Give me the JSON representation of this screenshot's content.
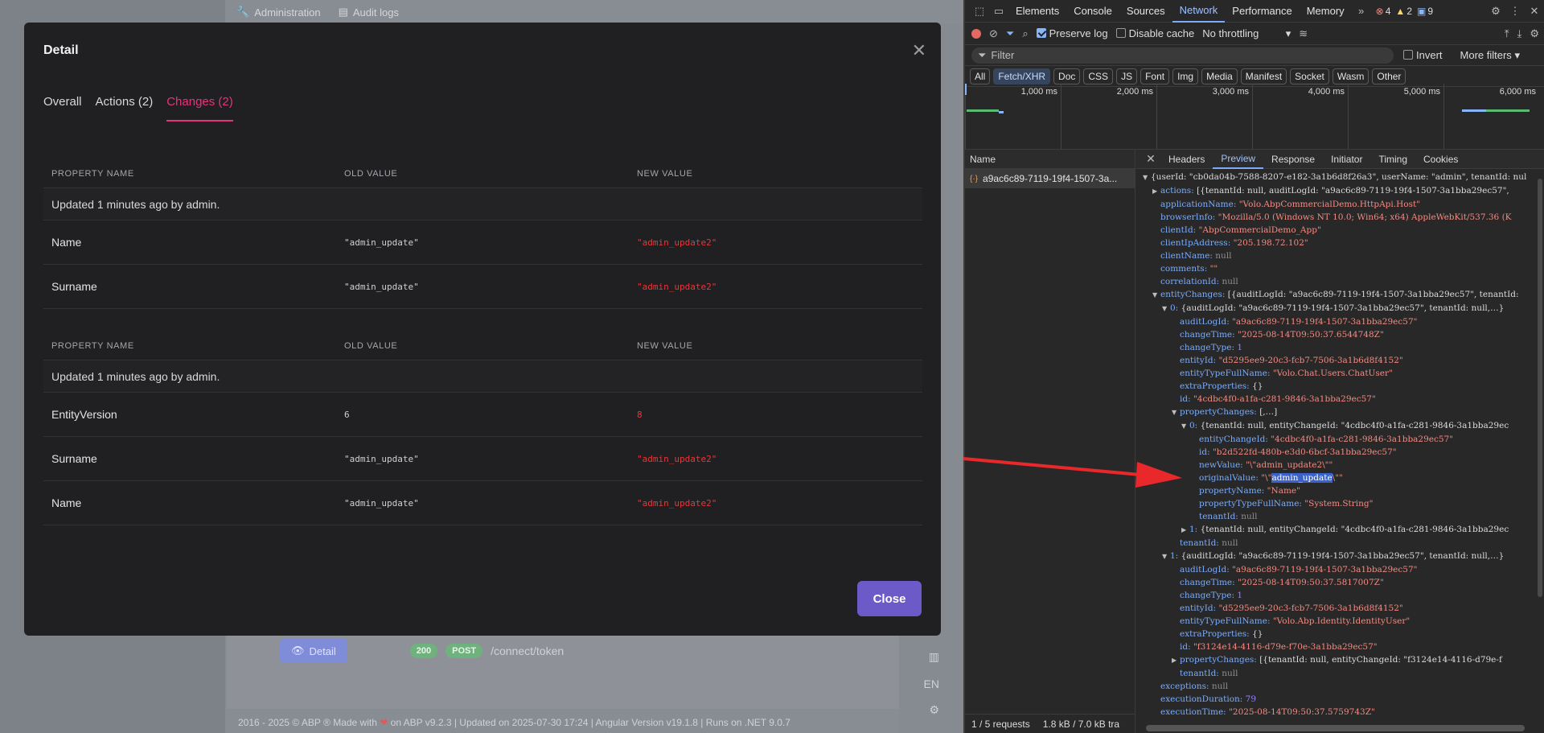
{
  "app": {
    "topbar": {
      "admin": "Administration",
      "audit": "Audit logs"
    },
    "bg_detail_button": "Detail",
    "bg_status": "200",
    "bg_method": "POST",
    "bg_path": "/connect/token",
    "lang": "EN",
    "footer_a": "2016 - 2025 © ABP ® Made with",
    "footer_b": "on ABP v9.2.3 | Updated on 2025-07-30 17:24 | Angular Version v19.1.8 | Runs on .NET 9.0.7"
  },
  "modal": {
    "title": "Detail",
    "tabs": [
      "Overall",
      "Actions (2)",
      "Changes (2)"
    ],
    "active_tab": 2,
    "headers": [
      "PROPERTY NAME",
      "OLD VALUE",
      "NEW VALUE"
    ],
    "groups": [
      {
        "meta": "Updated 1 minutes ago by admin.",
        "rows": [
          {
            "prop": "Name",
            "old": "\"admin_update\"",
            "new": "\"admin_update2\""
          },
          {
            "prop": "Surname",
            "old": "\"admin_update\"",
            "new": "\"admin_update2\""
          }
        ]
      },
      {
        "meta": "Updated 1 minutes ago by admin.",
        "rows": [
          {
            "prop": "EntityVersion",
            "old": "6",
            "new": "8"
          },
          {
            "prop": "Surname",
            "old": "\"admin_update\"",
            "new": "\"admin_update2\""
          },
          {
            "prop": "Name",
            "old": "\"admin_update\"",
            "new": "\"admin_update2\""
          }
        ]
      }
    ],
    "close_button": "Close"
  },
  "devtools": {
    "tabs": [
      "Elements",
      "Console",
      "Sources",
      "Network",
      "Performance",
      "Memory"
    ],
    "active_tab": "Network",
    "errors": "4",
    "warnings": "2",
    "infos": "9",
    "preserve_log": "Preserve log",
    "disable_cache": "Disable cache",
    "throttling": "No throttling",
    "filter_placeholder": "Filter",
    "invert": "Invert",
    "more_filters": "More filters",
    "types": [
      "All",
      "Fetch/XHR",
      "Doc",
      "CSS",
      "JS",
      "Font",
      "Img",
      "Media",
      "Manifest",
      "Socket",
      "Wasm",
      "Other"
    ],
    "active_type": "Fetch/XHR",
    "timeline_labels": [
      "1,000 ms",
      "2,000 ms",
      "3,000 ms",
      "4,000 ms",
      "5,000 ms",
      "6,000 ms"
    ],
    "name_header": "Name",
    "request_name": "a9ac6c89-7119-19f4-1507-3a...",
    "requests_count": "1 / 5 requests",
    "transfer": "1.8 kB / 7.0 kB tra",
    "preview_tabs": [
      "Headers",
      "Preview",
      "Response",
      "Initiator",
      "Timing",
      "Cookies"
    ],
    "active_preview_tab": "Preview",
    "tree": [
      {
        "i": 0,
        "t": "▼",
        "k": "",
        "v": "{userId: \"cb0da04b-7588-8207-e182-3a1b6d8f26a3\", userName: \"admin\", tenantId: nul"
      },
      {
        "i": 1,
        "t": "▶",
        "k": "actions",
        "v": "[{tenantId: null, auditLogId: \"a9ac6c89-7119-19f4-1507-3a1bba29ec57\","
      },
      {
        "i": 1,
        "t": "",
        "k": "applicationName",
        "v": "\"Volo.AbpCommercialDemo.HttpApi.Host\"",
        "c": "s"
      },
      {
        "i": 1,
        "t": "",
        "k": "browserInfo",
        "v": "\"Mozilla/5.0 (Windows NT 10.0; Win64; x64) AppleWebKit/537.36 (K",
        "c": "s"
      },
      {
        "i": 1,
        "t": "",
        "k": "clientId",
        "v": "\"AbpCommercialDemo_App\"",
        "c": "s"
      },
      {
        "i": 1,
        "t": "",
        "k": "clientIpAddress",
        "v": "\"205.198.72.102\"",
        "c": "s"
      },
      {
        "i": 1,
        "t": "",
        "k": "clientName",
        "v": "null",
        "c": "nl"
      },
      {
        "i": 1,
        "t": "",
        "k": "comments",
        "v": "\"\"",
        "c": "s"
      },
      {
        "i": 1,
        "t": "",
        "k": "correlationId",
        "v": "null",
        "c": "nl"
      },
      {
        "i": 1,
        "t": "▼",
        "k": "entityChanges",
        "v": "[{auditLogId: \"a9ac6c89-7119-19f4-1507-3a1bba29ec57\", tenantId:"
      },
      {
        "i": 2,
        "t": "▼",
        "k": "0",
        "v": "{auditLogId: \"a9ac6c89-7119-19f4-1507-3a1bba29ec57\", tenantId: null,…}"
      },
      {
        "i": 3,
        "t": "",
        "k": "auditLogId",
        "v": "\"a9ac6c89-7119-19f4-1507-3a1bba29ec57\"",
        "c": "s"
      },
      {
        "i": 3,
        "t": "",
        "k": "changeTime",
        "v": "\"2025-08-14T09:50:37.6544748Z\"",
        "c": "s"
      },
      {
        "i": 3,
        "t": "",
        "k": "changeType",
        "v": "1",
        "c": "n"
      },
      {
        "i": 3,
        "t": "",
        "k": "entityId",
        "v": "\"d5295ee9-20c3-fcb7-7506-3a1b6d8f4152\"",
        "c": "s"
      },
      {
        "i": 3,
        "t": "",
        "k": "entityTypeFullName",
        "v": "\"Volo.Chat.Users.ChatUser\"",
        "c": "s"
      },
      {
        "i": 3,
        "t": "",
        "k": "extraProperties",
        "v": "{}"
      },
      {
        "i": 3,
        "t": "",
        "k": "id",
        "v": "\"4cdbc4f0-a1fa-c281-9846-3a1bba29ec57\"",
        "c": "s"
      },
      {
        "i": 3,
        "t": "▼",
        "k": "propertyChanges",
        "v": "[,…]"
      },
      {
        "i": 4,
        "t": "▼",
        "k": "0",
        "v": "{tenantId: null, entityChangeId: \"4cdbc4f0-a1fa-c281-9846-3a1bba29ec"
      },
      {
        "i": 5,
        "t": "",
        "k": "entityChangeId",
        "v": "\"4cdbc4f0-a1fa-c281-9846-3a1bba29ec57\"",
        "c": "s"
      },
      {
        "i": 5,
        "t": "",
        "k": "id",
        "v": "\"b2d522fd-480b-e3d0-6bcf-3a1bba29ec57\"",
        "c": "s"
      },
      {
        "i": 5,
        "t": "",
        "k": "newValue",
        "v": "\"\\\"admin_update2\\\"\"",
        "c": "s"
      },
      {
        "i": 5,
        "t": "",
        "k": "originalValue",
        "v": "\"\\\"admin_update\\\"\"",
        "c": "s",
        "hl": "admin_update"
      },
      {
        "i": 5,
        "t": "",
        "k": "propertyName",
        "v": "\"Name\"",
        "c": "s"
      },
      {
        "i": 5,
        "t": "",
        "k": "propertyTypeFullName",
        "v": "\"System.String\"",
        "c": "s"
      },
      {
        "i": 5,
        "t": "",
        "k": "tenantId",
        "v": "null",
        "c": "nl"
      },
      {
        "i": 4,
        "t": "▶",
        "k": "1",
        "v": "{tenantId: null, entityChangeId: \"4cdbc4f0-a1fa-c281-9846-3a1bba29ec"
      },
      {
        "i": 3,
        "t": "",
        "k": "tenantId",
        "v": "null",
        "c": "nl"
      },
      {
        "i": 2,
        "t": "▼",
        "k": "1",
        "v": "{auditLogId: \"a9ac6c89-7119-19f4-1507-3a1bba29ec57\", tenantId: null,…}"
      },
      {
        "i": 3,
        "t": "",
        "k": "auditLogId",
        "v": "\"a9ac6c89-7119-19f4-1507-3a1bba29ec57\"",
        "c": "s"
      },
      {
        "i": 3,
        "t": "",
        "k": "changeTime",
        "v": "\"2025-08-14T09:50:37.5817007Z\"",
        "c": "s"
      },
      {
        "i": 3,
        "t": "",
        "k": "changeType",
        "v": "1",
        "c": "n"
      },
      {
        "i": 3,
        "t": "",
        "k": "entityId",
        "v": "\"d5295ee9-20c3-fcb7-7506-3a1b6d8f4152\"",
        "c": "s"
      },
      {
        "i": 3,
        "t": "",
        "k": "entityTypeFullName",
        "v": "\"Volo.Abp.Identity.IdentityUser\"",
        "c": "s"
      },
      {
        "i": 3,
        "t": "",
        "k": "extraProperties",
        "v": "{}"
      },
      {
        "i": 3,
        "t": "",
        "k": "id",
        "v": "\"f3124e14-4116-d79e-f70e-3a1bba29ec57\"",
        "c": "s"
      },
      {
        "i": 3,
        "t": "▶",
        "k": "propertyChanges",
        "v": "[{tenantId: null, entityChangeId: \"f3124e14-4116-d79e-f"
      },
      {
        "i": 3,
        "t": "",
        "k": "tenantId",
        "v": "null",
        "c": "nl"
      },
      {
        "i": 1,
        "t": "",
        "k": "exceptions",
        "v": "null",
        "c": "nl"
      },
      {
        "i": 1,
        "t": "",
        "k": "executionDuration",
        "v": "79",
        "c": "n"
      },
      {
        "i": 1,
        "t": "",
        "k": "executionTime",
        "v": "\"2025-08-14T09:50:37.5759743Z\"",
        "c": "s"
      }
    ]
  }
}
